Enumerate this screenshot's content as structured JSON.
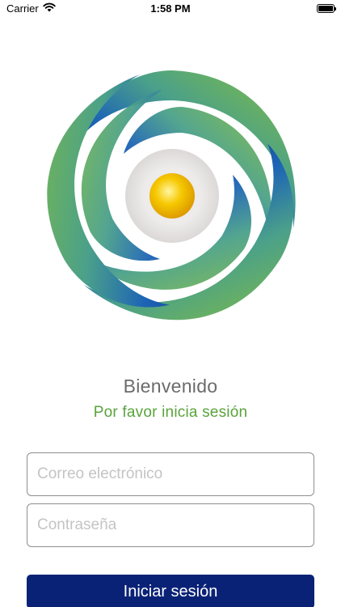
{
  "status_bar": {
    "carrier": "Carrier",
    "time": "1:58 PM",
    "wifi_icon": "wifi-icon",
    "battery_icon": "battery-icon"
  },
  "logo": {
    "icon": "swirl-sun-logo",
    "colors": {
      "dark_blue": "#0b2a8c",
      "green": "#7ab642",
      "sun": "#f0b400",
      "halo": "#e6e3e3"
    }
  },
  "welcome": {
    "title": "Bienvenido",
    "subtitle": "Por favor inicia sesión"
  },
  "form": {
    "email_placeholder": "Correo electrónico",
    "email_value": "",
    "password_placeholder": "Contraseña",
    "password_value": "",
    "login_label": "Iniciar sesión"
  },
  "theme": {
    "accent_green": "#5aa33c",
    "button_blue": "#0a2276",
    "title_gray": "#6b6b6b"
  }
}
